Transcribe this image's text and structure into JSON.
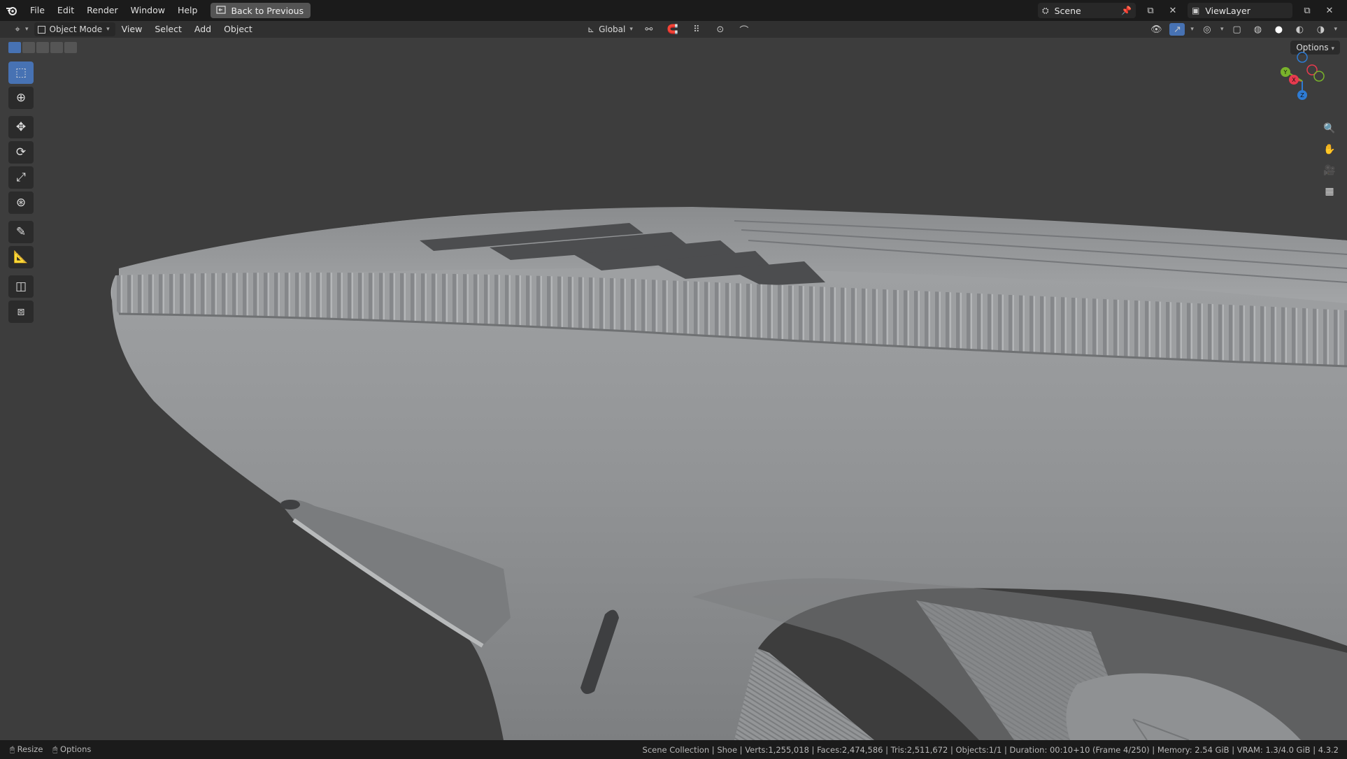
{
  "menu": {
    "items": [
      "File",
      "Edit",
      "Render",
      "Window",
      "Help"
    ],
    "back_button": "Back to Previous"
  },
  "topbar": {
    "scene": "Scene",
    "view_layer": "ViewLayer"
  },
  "header": {
    "mode": "Object Mode",
    "menus": [
      "View",
      "Select",
      "Add",
      "Object"
    ],
    "transform_orientation": "Global"
  },
  "viewport": {
    "options_label": "Options",
    "gizmo_axes": [
      "X",
      "Y",
      "Z"
    ],
    "colors": {
      "x_axis": "#e83a4e",
      "y_axis": "#79b32b",
      "z_axis": "#2e7bd3",
      "active_tool": "#4772b3"
    }
  },
  "toolbar": {
    "tools": [
      "select-box",
      "cursor",
      "move",
      "rotate",
      "scale",
      "transform",
      "annotate",
      "measure",
      "add-cube",
      "extrude"
    ],
    "active": "select-box"
  },
  "statusbar": {
    "left": [
      "Resize",
      "Options"
    ],
    "stats": "Scene Collection | Shoe | Verts:1,255,018 | Faces:2,474,586 | Tris:2,511,672 | Objects:1/1 | Duration: 00:10+10 (Frame 4/250) | Memory: 2.54 GiB | VRAM: 1.3/4.0 GiB | 4.3.2"
  }
}
